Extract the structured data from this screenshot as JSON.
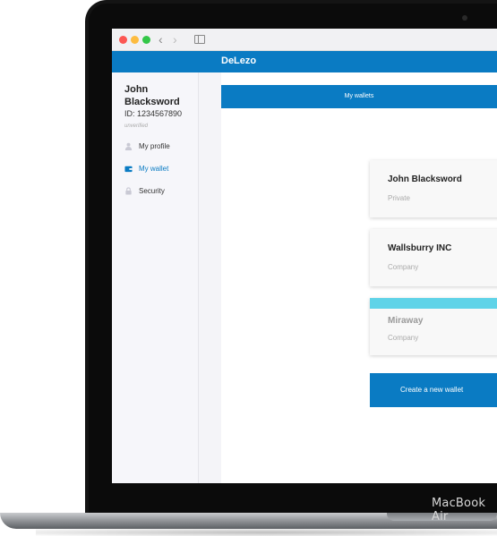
{
  "device": {
    "label": "MacBook Air"
  },
  "app": {
    "brand": "DeLezo"
  },
  "user": {
    "name": "John Blacksword",
    "id": "ID: 1234567890",
    "status": "unverified"
  },
  "sidebar": {
    "items": [
      {
        "label": "My profile",
        "icon": "user-icon",
        "active": false
      },
      {
        "label": "My wallet",
        "icon": "wallet-icon",
        "active": true
      },
      {
        "label": "Security",
        "icon": "lock-icon",
        "active": false
      }
    ]
  },
  "main": {
    "title": "My wallets",
    "wallets": [
      {
        "name": "John Blacksword",
        "type": "Private"
      },
      {
        "name": "Wallsburry INC",
        "type": "Company"
      },
      {
        "name": "Miraway",
        "type": "Company"
      }
    ],
    "create_label": "Create a new wallet"
  },
  "colors": {
    "accent": "#0a7bc3",
    "highlight_stripe": "#5fd3e8",
    "window_close": "#fc5753",
    "window_minimize": "#fdbc40",
    "window_maximize": "#33c748"
  }
}
